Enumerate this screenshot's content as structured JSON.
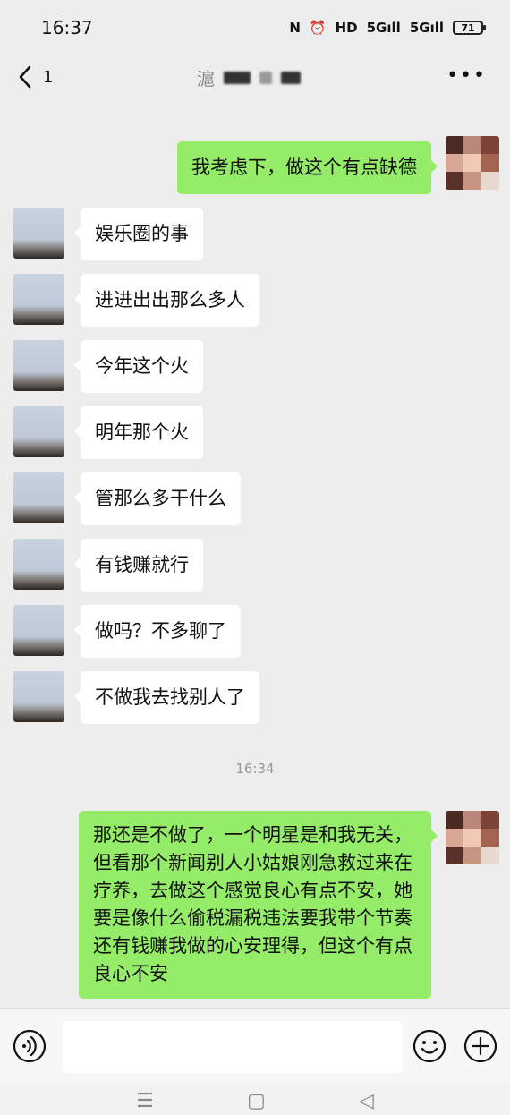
{
  "status": {
    "time": "16:37",
    "nfc": "N",
    "alarm": "⏰",
    "hd": "HD",
    "net1": "5G",
    "net2": "5G",
    "battery": "71"
  },
  "header": {
    "unread_count": "1",
    "contact_name_initial": "滬"
  },
  "messages": [
    {
      "side": "out",
      "text": "我考虑下，做这个有点缺德"
    },
    {
      "side": "in",
      "text": "娱乐圈的事"
    },
    {
      "side": "in",
      "text": "进进出出那么多人"
    },
    {
      "side": "in",
      "text": "今年这个火"
    },
    {
      "side": "in",
      "text": "明年那个火"
    },
    {
      "side": "in",
      "text": "管那么多干什么"
    },
    {
      "side": "in",
      "text": "有钱赚就行"
    },
    {
      "side": "in",
      "text": "做吗？不多聊了"
    },
    {
      "side": "in",
      "text": "不做我去找别人了"
    },
    {
      "side": "time",
      "text": "16:34"
    },
    {
      "side": "out",
      "text": "那还是不做了，一个明星是和我无关，但看那个新闻别人小姑娘刚急救过来在疗养，去做这个感觉良心有点不安，她要是像什么偷税漏税违法要我带个节奏还有钱赚我做的心安理得，但这个有点良心不安"
    }
  ],
  "colors": {
    "out_bubble": "#95ec69",
    "in_bubble": "#ffffff",
    "background": "#ededed"
  },
  "icons": {
    "back": "chevron-left-icon",
    "more": "more-dots-icon",
    "voice": "voice-icon",
    "emoji": "emoji-icon",
    "plus": "plus-icon"
  }
}
